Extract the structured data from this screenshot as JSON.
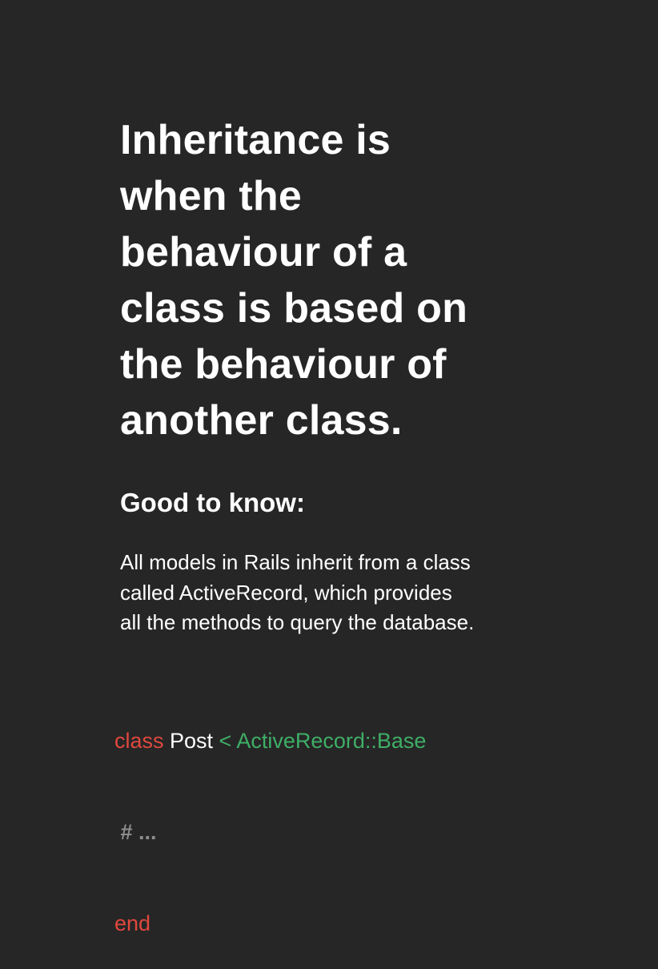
{
  "headline": {
    "lines": [
      "Inheritance is",
      "when the",
      "behaviour of a",
      "class is based on",
      "the behaviour of",
      "another class."
    ]
  },
  "subheading": "Good to know:",
  "body": {
    "lines": [
      "All models in Rails inherit from a class",
      "called ActiveRecord, which provides",
      "all the methods to query the database."
    ]
  },
  "code": {
    "keyword_class": "class",
    "class_name": " Post",
    "superclass": " < ActiveRecord::Base",
    "comment": " # ...",
    "keyword_end": "end",
    "colors": {
      "keyword": "#e0483e",
      "superclass": "#3fae66",
      "comment": "#8c8c8c",
      "background": "#262626"
    }
  }
}
